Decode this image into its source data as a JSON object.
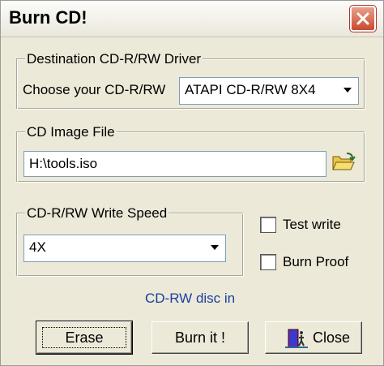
{
  "window": {
    "title": "Burn CD!"
  },
  "destination": {
    "group_label": "Destination CD-R/RW Driver",
    "choose_label": "Choose your CD-R/RW",
    "drive_value": "ATAPI   CD-R/RW 8X4"
  },
  "image_file": {
    "group_label": "CD Image File",
    "path_value": "H:\\tools.iso"
  },
  "speed": {
    "group_label": "CD-R/RW Write Speed",
    "value": "4X"
  },
  "options": {
    "test_write_label": "Test write",
    "test_write_checked": false,
    "burn_proof_label": "Burn Proof",
    "burn_proof_checked": false
  },
  "status_text": "CD-RW disc in",
  "buttons": {
    "erase": "Erase",
    "burn": "Burn it !",
    "close": "Close"
  },
  "icons": {
    "window_close": "x-icon",
    "browse": "folder-open-icon",
    "dropdown": "chevron-down-icon",
    "close_button": "exit-door-icon"
  }
}
